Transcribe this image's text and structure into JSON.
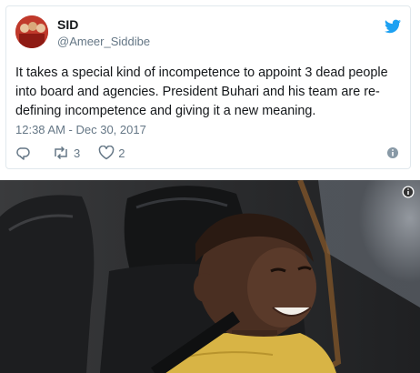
{
  "tweet": {
    "name": "SID",
    "handle": "@Ameer_Siddibe",
    "text": "It takes a special kind of incompetence to appoint 3 dead people into board and agencies. President Buhari and his team are re-defining incompetence and giving it a new meaning.",
    "timestamp": "12:38 AM - Dec 30, 2017",
    "retweet_count": "3",
    "like_count": "2"
  },
  "icons": {
    "brand": "twitter-bird-icon",
    "reply": "reply-icon",
    "retweet": "retweet-icon",
    "like": "heart-icon",
    "info": "info-icon"
  },
  "colors": {
    "brand_blue": "#1da1f2",
    "secondary_text": "#657786",
    "border": "#e1e8ed"
  }
}
